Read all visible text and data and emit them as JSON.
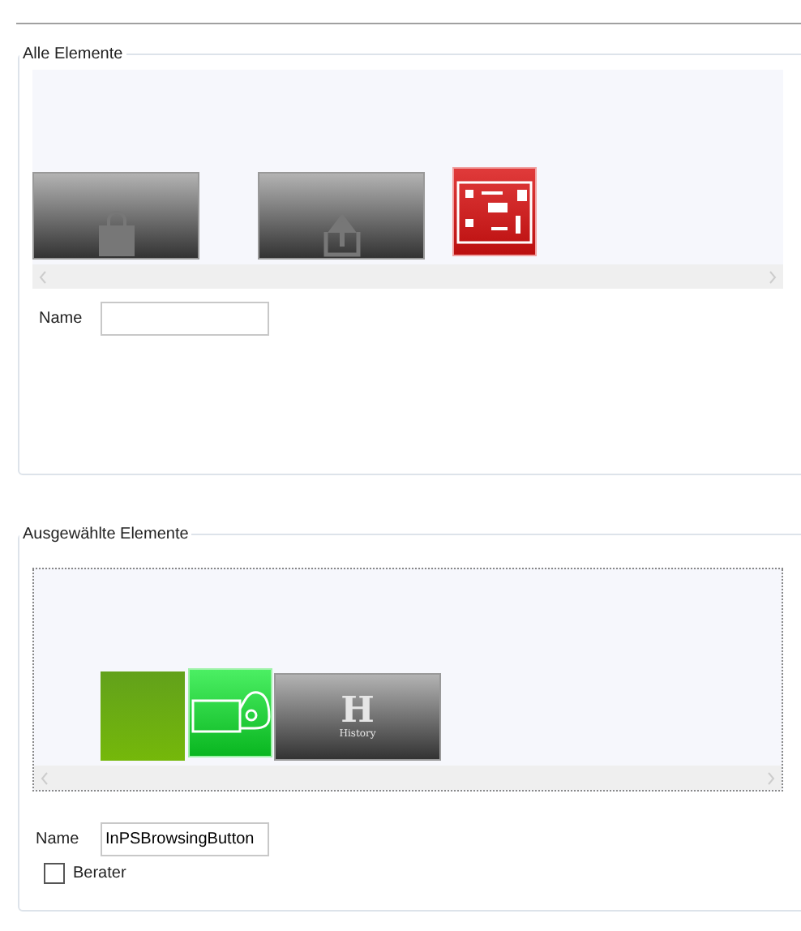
{
  "groups": [
    {
      "title": "Alle Elemente",
      "dotted": false,
      "tiles": [
        {
          "kind": "bag"
        },
        {
          "kind": "upload"
        },
        {
          "kind": "board"
        }
      ],
      "name_label": "Name"
    },
    {
      "title": "Ausgewählte Elemente",
      "dotted": true,
      "tiles": [
        {
          "kind": "plain"
        },
        {
          "kind": "card-hand"
        },
        {
          "kind": "history",
          "letter": "H",
          "caption": "History"
        }
      ],
      "name_label": "Name",
      "name_value": "InPSBrowsingButton",
      "checkbox": {
        "label": "Berater",
        "checked": false
      }
    }
  ]
}
